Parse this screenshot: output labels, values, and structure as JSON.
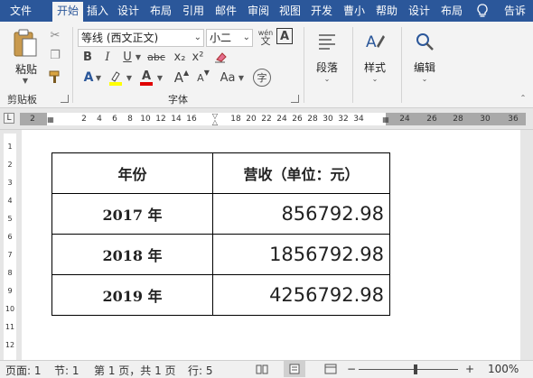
{
  "tabs": [
    "文件",
    "开始",
    "插入",
    "设计",
    "布局",
    "引用",
    "邮件",
    "审阅",
    "视图",
    "开发",
    "曹小",
    "帮助",
    "设计",
    "布局"
  ],
  "tell_me": "告诉",
  "ribbon": {
    "clipboard": {
      "paste_label": "粘贴",
      "group_label": "剪贴板"
    },
    "font": {
      "font_name": "等线 (西文正文)",
      "font_size": "小二",
      "phonetic_label": "wén",
      "bold": "B",
      "italic": "I",
      "underline": "U",
      "strikethrough": "abc",
      "subscript": "x₂",
      "superscript": "x²",
      "grow": "A",
      "shrink": "A",
      "case": "Aa",
      "char_border": "A",
      "enclose_char": "字",
      "group_label": "字体"
    },
    "paragraph_label": "段落",
    "styles_label": "样式",
    "editing_label": "编辑"
  },
  "ruler": {
    "tab_selector": "L",
    "left_numbers": [
      "2"
    ],
    "numbers": [
      "2",
      "4",
      "6",
      "8",
      "10",
      "12",
      "14",
      "16",
      "18",
      "20",
      "22",
      "24",
      "26",
      "28",
      "30",
      "32",
      "34",
      "36"
    ],
    "vertical_numbers": [
      "1",
      "2",
      "3",
      "4",
      "5",
      "6",
      "7",
      "8",
      "9",
      "10",
      "11",
      "12"
    ]
  },
  "document": {
    "table": {
      "headers": [
        "年份",
        "营收（单位：元）"
      ],
      "rows": [
        {
          "year": "2017 年",
          "value": "856792.98"
        },
        {
          "year": "2018 年",
          "value": "1856792.98"
        },
        {
          "year": "2019 年",
          "value": "4256792.98"
        }
      ]
    }
  },
  "status": {
    "page": "页面: 1",
    "section": "节: 1",
    "pages": "第 1 页，共 1 页",
    "line": "行: 5",
    "zoom_minus": "−",
    "zoom_plus": "+",
    "zoom_level": "100%"
  }
}
